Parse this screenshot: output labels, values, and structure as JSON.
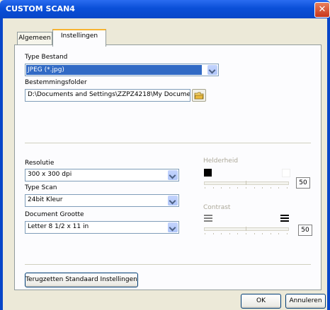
{
  "window": {
    "title": "CUSTOM SCAN4",
    "close_glyph": "✕"
  },
  "tabs": [
    {
      "label": "Algemeen"
    },
    {
      "label": "Instellingen"
    }
  ],
  "file_type": {
    "label": "Type Bestand",
    "value": "JPEG (*.jpg)"
  },
  "destination": {
    "label": "Bestemmingsfolder",
    "value": "D:\\Documents and Settings\\ZZPZ4218\\My Documen",
    "icon": "folder-icon"
  },
  "resolution": {
    "label": "Resolutie",
    "value": "300 x 300 dpi"
  },
  "scan_type": {
    "label": "Type Scan",
    "value": "24bit Kleur"
  },
  "document_size": {
    "label": "Document Grootte",
    "value": "Letter 8 1/2 x 11 in"
  },
  "brightness": {
    "label": "Helderheid",
    "value": "50",
    "level": 0.5
  },
  "contrast": {
    "label": "Contrast",
    "value": "50",
    "level": 0.5
  },
  "buttons": {
    "reset": "Terugzetten Standaard Instellingen",
    "ok": "OK",
    "cancel": "Annuleren"
  }
}
